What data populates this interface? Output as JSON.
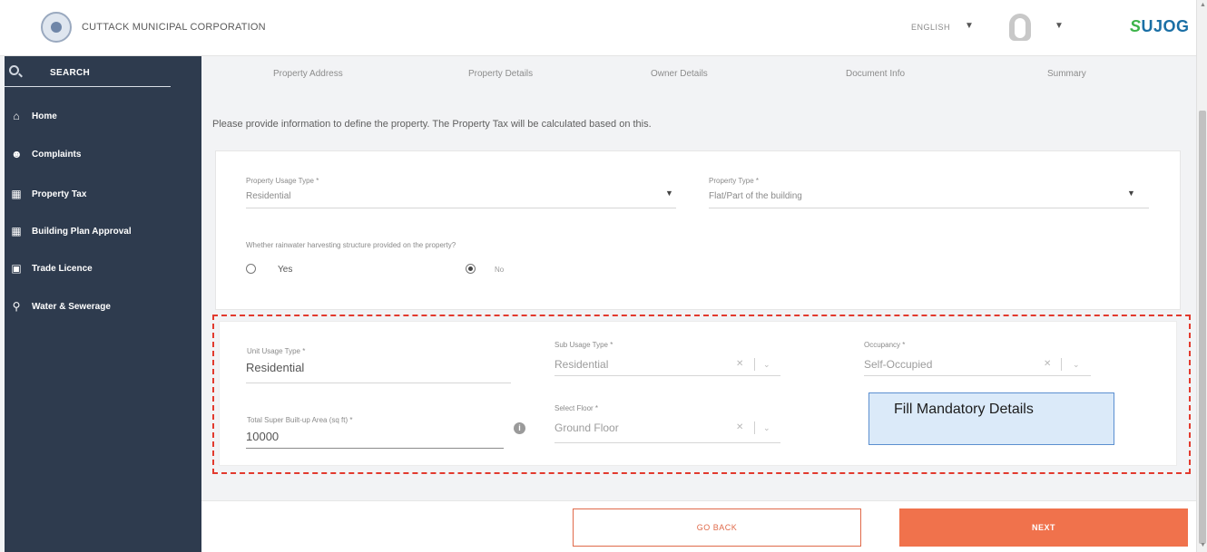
{
  "header": {
    "org_name": "CUTTACK MUNICIPAL CORPORATION",
    "language": "ENGLISH",
    "brand": "SUJOG",
    "brand_prefix": "S",
    "brand_rest": "UJOG"
  },
  "sidebar": {
    "search_label": "SEARCH",
    "items": [
      {
        "label": "Home",
        "icon": "home-icon"
      },
      {
        "label": "Complaints",
        "icon": "complaints-icon"
      },
      {
        "label": "Property Tax",
        "icon": "property-tax-icon"
      },
      {
        "label": "Building Plan Approval",
        "icon": "building-plan-icon"
      },
      {
        "label": "Trade Licence",
        "icon": "trade-licence-icon"
      },
      {
        "label": "Water & Sewerage",
        "icon": "water-tap-icon"
      }
    ]
  },
  "stepper": {
    "steps": [
      "Property Address",
      "Property Details",
      "Owner Details",
      "Document Info",
      "Summary"
    ]
  },
  "intro_text": "Please provide information to define the property. The Property Tax will be calculated based on this.",
  "property_form": {
    "usage_type": {
      "label": "Property Usage Type *",
      "value": "Residential"
    },
    "property_type": {
      "label": "Property Type *",
      "value": "Flat/Part of the building"
    },
    "rainwater_question": "Whether rainwater harvesting structure provided on the property?",
    "rainwater_options": [
      "Yes",
      "No"
    ],
    "rainwater_selected": "No"
  },
  "unit_form": {
    "unit_usage_type": {
      "label": "Unit Usage Type *",
      "value": "Residential"
    },
    "sub_usage_type": {
      "label": "Sub Usage Type *",
      "value": "Residential"
    },
    "occupancy": {
      "label": "Occupancy *",
      "value": "Self-Occupied"
    },
    "built_up_area": {
      "label": "Total Super Built-up Area (sq ft) *",
      "value": "10000"
    },
    "select_floor": {
      "label": "Select Floor *",
      "value": "Ground Floor"
    }
  },
  "annotation": {
    "callout_text": "Fill Mandatory Details",
    "border_color": "#e23a2e"
  },
  "footer": {
    "back_label": "GO BACK",
    "next_label": "NEXT"
  },
  "colors": {
    "sidebar_bg": "#2e3b4e",
    "accent": "#f0724c",
    "brand_blue": "#1a6fa5",
    "brand_green": "#3db34a"
  }
}
